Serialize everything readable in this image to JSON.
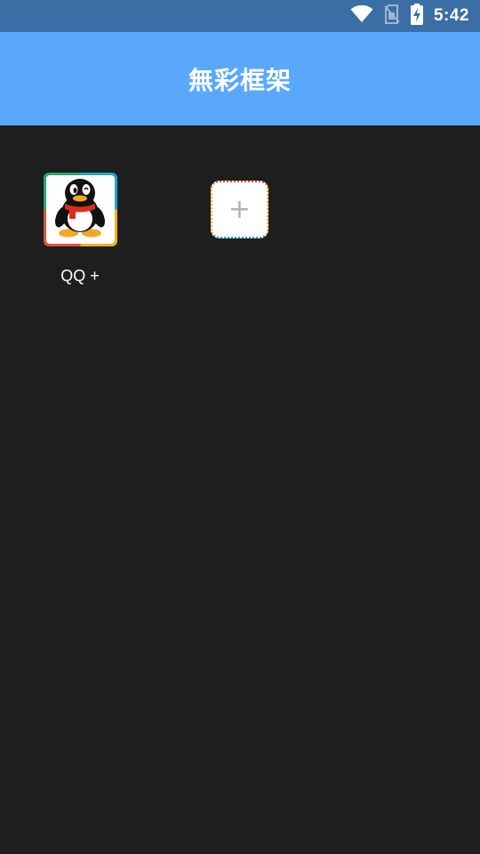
{
  "status_bar": {
    "time": "5:42",
    "icons": [
      "wifi-icon",
      "no-sim-icon",
      "battery-charging-icon"
    ]
  },
  "app_bar": {
    "title": "無彩框架"
  },
  "apps": [
    {
      "label": "QQ +",
      "icon": "qq-penguin-icon"
    }
  ],
  "add_tile": {
    "glyph": "+",
    "icon": "add-icon"
  },
  "colors": {
    "status_bar_bg": "#3a6ea5",
    "app_bar_bg": "#5aa8fe",
    "content_bg": "#1e1e1e",
    "frame_teal": "#1fa8c9",
    "frame_yellow": "#f2b01e",
    "frame_red": "#e0523a",
    "frame_green": "#27a96b"
  }
}
